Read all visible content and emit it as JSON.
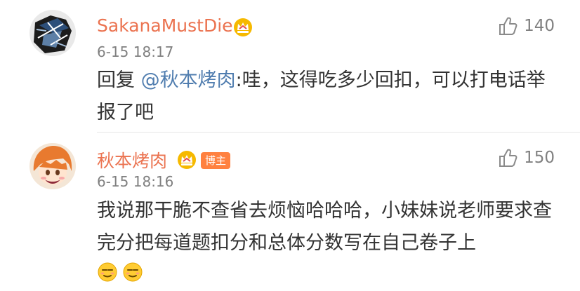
{
  "comments": [
    {
      "username": "SakanaMustDie",
      "time": "6-15 18:17",
      "likes": "140",
      "reply_prefix": "回复",
      "mention": "@秋本烤肉",
      "text": ":哇，这得吃多少回扣，可以打电话举报了吧",
      "vip_icon": "crown-vip-icon",
      "colors": {
        "username": "#eb7350",
        "mention": "#507daf"
      }
    },
    {
      "username": "秋本烤肉",
      "time": "6-15 18:16",
      "likes": "150",
      "badge": "博主",
      "text": "我说那干脆不查省去烦恼哈哈哈，小妹妹说老师要求查完分把每道题扣分和总体分数写在自己卷子上",
      "vip_icon": "crown-vip-icon",
      "emojis": [
        "smirk-emoji",
        "smirk-emoji"
      ],
      "colors": {
        "username": "#eb7350",
        "badge_bg": "#ff8140"
      }
    }
  ]
}
